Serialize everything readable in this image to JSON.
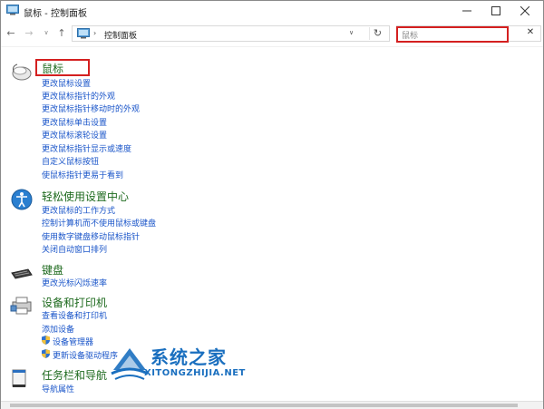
{
  "window": {
    "title": "鼠标 - 控制面板",
    "controls": {
      "minimize": "—",
      "maximize": "☐",
      "close": "✕"
    }
  },
  "nav": {
    "back": "←",
    "forward": "→",
    "dropdown": "∨",
    "up": "↑"
  },
  "address": {
    "separator": "›",
    "path": "控制面板",
    "dropdown": "∨",
    "refresh": "↻"
  },
  "search": {
    "value": "鼠标",
    "clear": "✕"
  },
  "sections": [
    {
      "icon": "mouse-icon",
      "title": "鼠标",
      "links": [
        "更改鼠标设置",
        "更改鼠标指针的外观",
        "更改鼠标指针移动时的外观",
        "更改鼠标单击设置",
        "更改鼠标滚轮设置",
        "更改鼠标指针显示或速度",
        "自定义鼠标按钮",
        "使鼠标指针更易于看到"
      ]
    },
    {
      "icon": "ease-of-access-icon",
      "title": "轻松使用设置中心",
      "links": [
        "更改鼠标的工作方式",
        "控制计算机而不使用鼠标或键盘",
        "使用数字键盘移动鼠标指针",
        "关闭自动窗口排列"
      ]
    },
    {
      "icon": "keyboard-icon",
      "title": "键盘",
      "links": [
        "更改光标闪烁速率"
      ]
    },
    {
      "icon": "printer-icon",
      "title": "设备和打印机",
      "links": [
        "查看设备和打印机",
        "添加设备",
        "设备管理器",
        "更新设备驱动程序"
      ]
    },
    {
      "icon": "taskbar-icon",
      "title": "任务栏和导航",
      "links": [
        "导航属性"
      ]
    }
  ],
  "watermark": {
    "title": "系统之家",
    "subtitle": "XITONGZHIJIA.NET"
  },
  "colors": {
    "title_green": "#1e6a1e",
    "link_blue": "#1a55c9",
    "highlight_red": "#d42020"
  }
}
